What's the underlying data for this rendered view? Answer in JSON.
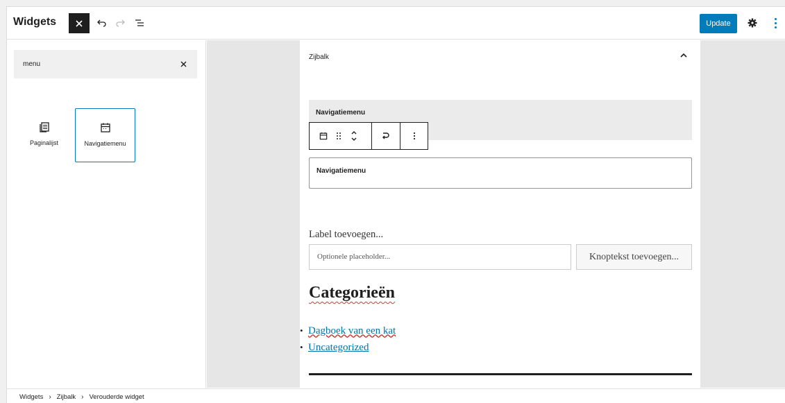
{
  "header": {
    "title": "Widgets",
    "update_label": "Update"
  },
  "inserter": {
    "search_value": "menu",
    "blocks": [
      {
        "label": "Paginalijst",
        "icon": "page-list-icon",
        "selected": false
      },
      {
        "label": "Navigatiemenu",
        "icon": "navigation-icon",
        "selected": true
      }
    ]
  },
  "canvas": {
    "area_title": "Zijbalk",
    "nav_block": {
      "group_title": "Navigatiemenu",
      "input_text": "Navigatiemenu"
    },
    "search_widget": {
      "label": "Label toevoegen...",
      "placeholder": "Optionele placeholder...",
      "button_text": "Knoptekst toevoegen..."
    },
    "categories": {
      "heading": "Categorieën",
      "items": [
        "Dagboek van een kat",
        "Uncategorized"
      ]
    }
  },
  "breadcrumb": [
    "Widgets",
    "Zijbalk",
    "Verouderde widget"
  ],
  "colors": {
    "accent": "#007cba",
    "dark": "#1e1e1e",
    "link": "#0073aa"
  }
}
